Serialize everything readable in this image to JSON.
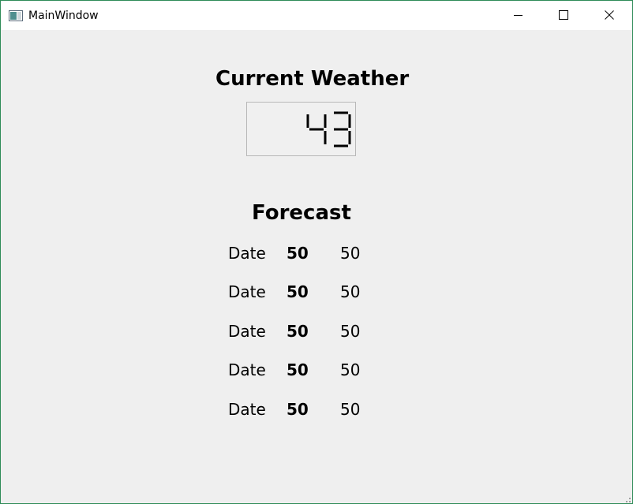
{
  "window": {
    "title": "MainWindow",
    "icon": "app-window-icon",
    "controls": [
      "minimize-icon",
      "maximize-icon",
      "close-icon"
    ]
  },
  "current": {
    "title": "Current Weather",
    "value": "43"
  },
  "forecast": {
    "title": "Forecast",
    "rows": [
      {
        "date": "Date",
        "high": "50",
        "low": "50"
      },
      {
        "date": "Date",
        "high": "50",
        "low": "50"
      },
      {
        "date": "Date",
        "high": "50",
        "low": "50"
      },
      {
        "date": "Date",
        "high": "50",
        "low": "50"
      },
      {
        "date": "Date",
        "high": "50",
        "low": "50"
      }
    ]
  },
  "colors": {
    "window_border": "#2e8b57",
    "client_background": "#efefef",
    "lcd_border": "#b8b8b8"
  }
}
